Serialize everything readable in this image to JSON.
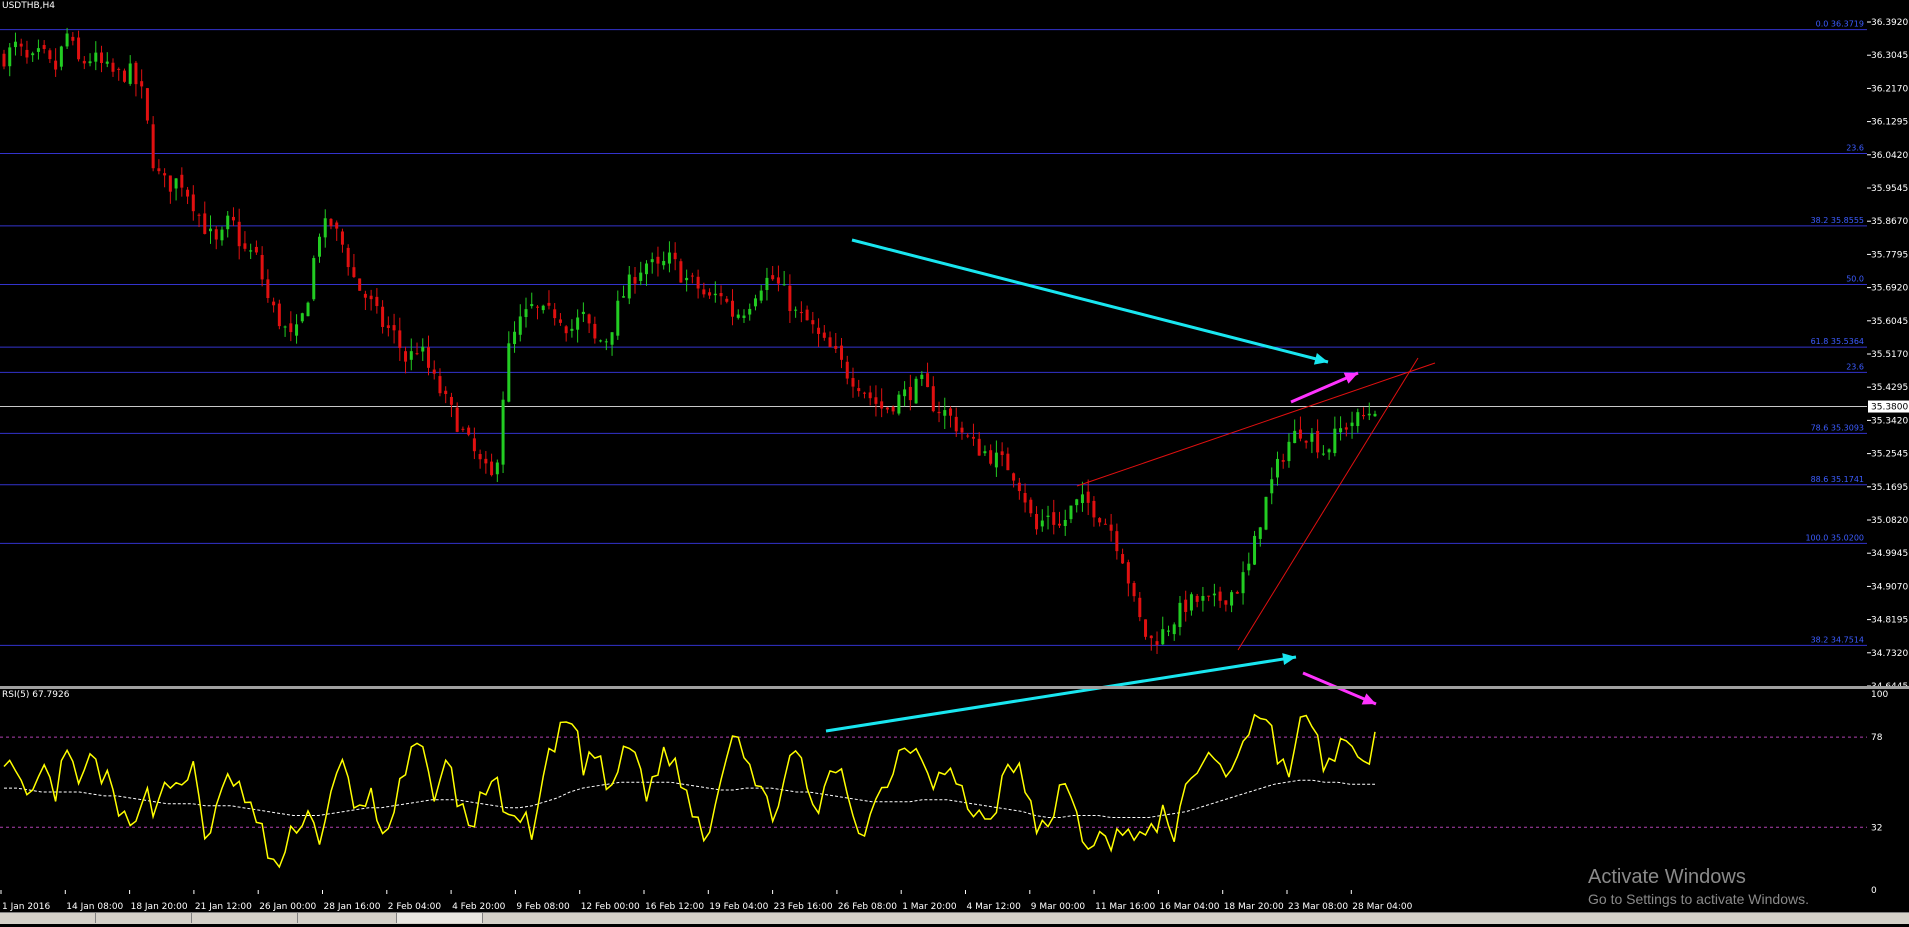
{
  "chart_data": [
    {
      "type": "candlestick",
      "title": "USDTHB,H4",
      "ylim": [
        34.6445,
        36.392
      ],
      "y_ticks": [
        "36.3920",
        "36.3045",
        "36.2170",
        "36.1295",
        "36.0420",
        "35.9545",
        "35.8670",
        "35.7795",
        "35.6920",
        "35.6045",
        "35.5170",
        "35.4295",
        "35.3420",
        "35.2545",
        "35.1695",
        "35.0820",
        "34.9945",
        "34.9070",
        "34.8195",
        "34.7320",
        "34.6445"
      ],
      "current_price": "35.3800",
      "x_ticks": [
        "1 Jan 2016",
        "14 Jan 08:00",
        "18 Jan 20:00",
        "21 Jan 12:00",
        "26 Jan 00:00",
        "28 Jan 16:00",
        "2 Feb 04:00",
        "4 Feb 20:00",
        "9 Feb 08:00",
        "12 Feb 00:00",
        "16 Feb 12:00",
        "19 Feb 04:00",
        "23 Feb 16:00",
        "26 Feb 08:00",
        "1 Mar 20:00",
        "4 Mar 12:00",
        "9 Mar 00:00",
        "11 Mar 16:00",
        "16 Mar 04:00",
        "18 Mar 20:00",
        "23 Mar 08:00",
        "28 Mar 04:00"
      ],
      "close_path": [
        36.3,
        36.33,
        36.28,
        36.31,
        36.26,
        36.36,
        36.28,
        36.3,
        36.27,
        36.25,
        36.26,
        36.2,
        36.0,
        35.96,
        35.98,
        35.92,
        35.85,
        35.8,
        35.88,
        35.79,
        35.78,
        35.66,
        35.6,
        35.55,
        35.64,
        35.84,
        35.86,
        35.8,
        35.7,
        35.66,
        35.6,
        35.57,
        35.5,
        35.54,
        35.46,
        35.4,
        35.34,
        35.28,
        35.22,
        35.18,
        35.52,
        35.6,
        35.64,
        35.62,
        35.63,
        35.58,
        35.62,
        35.55,
        35.56,
        35.66,
        35.72,
        35.76,
        35.74,
        35.77,
        35.72,
        35.7,
        35.66,
        35.68,
        35.62,
        35.64,
        35.7,
        35.72,
        35.68,
        35.62,
        35.6,
        35.55,
        35.52,
        35.47,
        35.44,
        35.4,
        35.37,
        35.4,
        35.42,
        35.44,
        35.38,
        35.36,
        35.32,
        35.28,
        35.26,
        35.24,
        35.22,
        35.16,
        35.05,
        35.1,
        35.06,
        35.12,
        35.13,
        35.1,
        35.06,
        34.98,
        34.84,
        34.76,
        34.78,
        34.82,
        34.86,
        34.87,
        34.86,
        34.88,
        34.9,
        34.96,
        35.1,
        35.2,
        35.28,
        35.32,
        35.3,
        35.26,
        35.31,
        35.34,
        35.35,
        35.38
      ],
      "fibonacci_levels": [
        {
          "label": "0.0 36.3719",
          "value": 36.3719
        },
        {
          "label": "23.6",
          "value": 36.046
        },
        {
          "label": "38.2 35.8555",
          "value": 35.8555
        },
        {
          "label": "50.0",
          "value": 35.701
        },
        {
          "label": "61.8 35.5364",
          "value": 35.5364
        },
        {
          "label": "23.6",
          "value": 35.47
        },
        {
          "label": "78.6 35.3093",
          "value": 35.3093
        },
        {
          "label": "88.6 35.1741",
          "value": 35.1741
        },
        {
          "label": "100.0 35.0200",
          "value": 35.02
        },
        {
          "label": "38.2 34.7514",
          "value": 34.7514
        }
      ],
      "price_line_value": 35.38,
      "colors": {
        "up": "#22cc22",
        "down": "#e01010",
        "fib": "#3333cc",
        "fib_text": "#3c5cff",
        "arrow_cyan": "#19e6f0",
        "arrow_magenta": "#ff33ff",
        "wedge": "#e01010",
        "axis_text": "#ffffff",
        "separator": "#a0a0a0"
      }
    },
    {
      "type": "line",
      "title": "RSI(5) 67.7926",
      "ylim": [
        0,
        100
      ],
      "y_ticks": [
        "100",
        "78",
        "32",
        "0"
      ],
      "levels": [
        78,
        32
      ],
      "series": [
        {
          "values": [
            70,
            55,
            40,
            62,
            48,
            68,
            54,
            66,
            58,
            40,
            30,
            52,
            40,
            61,
            45,
            66,
            28,
            40,
            60,
            48,
            36,
            20,
            10,
            30,
            42,
            26,
            48,
            64,
            36,
            52,
            28,
            42,
            60,
            76,
            48,
            66,
            50,
            30,
            46,
            64,
            30,
            42,
            24,
            60,
            76,
            90,
            64,
            70,
            50,
            64,
            76,
            48,
            64,
            70,
            52,
            38,
            28,
            60,
            86,
            70,
            48,
            40,
            56,
            70,
            46,
            42,
            64,
            52,
            30,
            40,
            54,
            68,
            76,
            70,
            56,
            62,
            50,
            40,
            36,
            46,
            64,
            60,
            28,
            32,
            56,
            40,
            24,
            30,
            18,
            36,
            28,
            24,
            40,
            30,
            48,
            64,
            72,
            56,
            70,
            84,
            92,
            76,
            56,
            86,
            82,
            62,
            74,
            70,
            60,
            78
          ]
        },
        {
          "values": [
            52,
            52,
            51,
            50,
            50,
            50,
            50,
            49,
            48,
            48,
            47,
            46,
            45,
            44,
            44,
            44,
            43,
            43,
            43,
            42,
            41,
            40,
            39,
            38,
            38,
            38,
            39,
            40,
            41,
            42,
            42,
            43,
            44,
            45,
            46,
            46,
            46,
            45,
            44,
            43,
            42,
            42,
            43,
            45,
            47,
            50,
            52,
            53,
            54,
            55,
            55,
            55,
            55,
            55,
            54,
            53,
            52,
            51,
            51,
            52,
            52,
            52,
            51,
            50,
            50,
            49,
            48,
            47,
            46,
            45,
            45,
            45,
            45,
            46,
            46,
            46,
            45,
            44,
            43,
            42,
            41,
            40,
            38,
            37,
            37,
            38,
            38,
            38,
            37,
            37,
            37,
            37,
            38,
            39,
            40,
            42,
            44,
            46,
            48,
            50,
            52,
            54,
            55,
            56,
            56,
            55,
            55,
            54,
            54,
            54
          ]
        }
      ],
      "colors": {
        "rsi": "#ffff00",
        "ma": "#ffffff",
        "level": "#b040b0",
        "arrow_cyan": "#19e6f0",
        "arrow_magenta": "#ff33ff"
      }
    }
  ],
  "watermark": {
    "line1": "Activate Windows",
    "line2": "Go to Settings to activate Windows."
  }
}
